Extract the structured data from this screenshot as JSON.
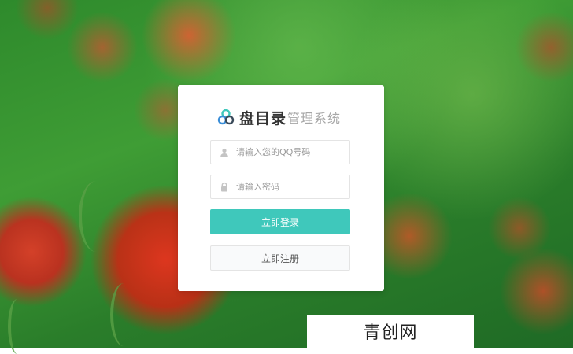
{
  "brand": {
    "name": "盘目录",
    "subtitle": "管理系统"
  },
  "form": {
    "qq": {
      "placeholder": "请输入您的QQ号码",
      "value": ""
    },
    "password": {
      "placeholder": "请输入密码",
      "value": ""
    },
    "login_label": "立即登录",
    "register_label": "立即注册"
  },
  "watermark": {
    "text": "青创网"
  },
  "colors": {
    "accent": "#3fc8bb",
    "logo_teal": "#3fc8bb",
    "logo_blue": "#3a8ed8",
    "logo_dark": "#3a4a5a"
  },
  "icons": {
    "logo": "triple-circle-logo-icon",
    "qq_field": "user-icon",
    "password_field": "lock-icon"
  }
}
